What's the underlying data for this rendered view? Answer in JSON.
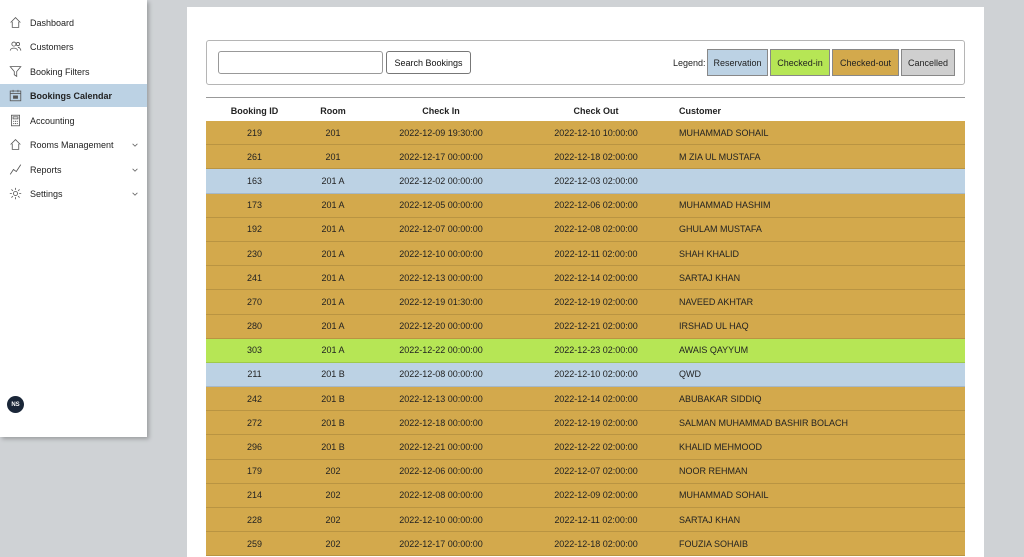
{
  "sidebar": {
    "items": [
      {
        "label": "Dashboard",
        "icon": "home-icon",
        "active": true,
        "chevron": false
      },
      {
        "label": "Customers",
        "icon": "users-icon",
        "active": false,
        "chevron": false
      },
      {
        "label": "Booking Filters",
        "icon": "filter-icon",
        "active": false,
        "chevron": false
      },
      {
        "label": "Bookings Calendar",
        "icon": "calendar-icon",
        "active": true,
        "chevron": false
      },
      {
        "label": "Accounting",
        "icon": "calculator-icon",
        "active": false,
        "chevron": false
      },
      {
        "label": "Rooms Management",
        "icon": "home-icon",
        "active": false,
        "chevron": true
      },
      {
        "label": "Reports",
        "icon": "chart-line-icon",
        "active": false,
        "chevron": true
      },
      {
        "label": "Settings",
        "icon": "gear-icon",
        "active": false,
        "chevron": true
      }
    ],
    "avatar": "NS"
  },
  "toolbar": {
    "search_placeholder": "",
    "search_value": "",
    "search_button": "Search Bookings",
    "legend_label": "Legend:",
    "legend": [
      {
        "label": "Reservation",
        "color": "#bcd2e4"
      },
      {
        "label": "Checked-in",
        "color": "#b6e655"
      },
      {
        "label": "Checked-out",
        "color": "#d3a94c"
      },
      {
        "label": "Cancelled",
        "color": "#cfcfcf"
      }
    ]
  },
  "table": {
    "headers": [
      "Booking ID",
      "Room",
      "Check In",
      "Check Out",
      "Customer"
    ],
    "rows": [
      {
        "id": "219",
        "room": "201",
        "check_in": "2022-12-09 19:30:00",
        "check_out": "2022-12-10 10:00:00",
        "customer": "MUHAMMAD SOHAIL",
        "status": "Checked-out"
      },
      {
        "id": "261",
        "room": "201",
        "check_in": "2022-12-17 00:00:00",
        "check_out": "2022-12-18 02:00:00",
        "customer": "M ZIA UL MUSTAFA",
        "status": "Checked-out"
      },
      {
        "id": "163",
        "room": "201 A",
        "check_in": "2022-12-02 00:00:00",
        "check_out": "2022-12-03 02:00:00",
        "customer": "",
        "status": "Reservation"
      },
      {
        "id": "173",
        "room": "201 A",
        "check_in": "2022-12-05 00:00:00",
        "check_out": "2022-12-06 02:00:00",
        "customer": "MUHAMMAD HASHIM",
        "status": "Checked-out"
      },
      {
        "id": "192",
        "room": "201 A",
        "check_in": "2022-12-07 00:00:00",
        "check_out": "2022-12-08 02:00:00",
        "customer": "GHULAM MUSTAFA",
        "status": "Checked-out"
      },
      {
        "id": "230",
        "room": "201 A",
        "check_in": "2022-12-10 00:00:00",
        "check_out": "2022-12-11 02:00:00",
        "customer": "SHAH KHALID",
        "status": "Checked-out"
      },
      {
        "id": "241",
        "room": "201 A",
        "check_in": "2022-12-13 00:00:00",
        "check_out": "2022-12-14 02:00:00",
        "customer": "SARTAJ KHAN",
        "status": "Checked-out"
      },
      {
        "id": "270",
        "room": "201 A",
        "check_in": "2022-12-19 01:30:00",
        "check_out": "2022-12-19 02:00:00",
        "customer": "NAVEED AKHTAR",
        "status": "Checked-out"
      },
      {
        "id": "280",
        "room": "201 A",
        "check_in": "2022-12-20 00:00:00",
        "check_out": "2022-12-21 02:00:00",
        "customer": "IRSHAD UL HAQ",
        "status": "Checked-out"
      },
      {
        "id": "303",
        "room": "201 A",
        "check_in": "2022-12-22 00:00:00",
        "check_out": "2022-12-23 02:00:00",
        "customer": "AWAIS QAYYUM",
        "status": "Checked-in"
      },
      {
        "id": "211",
        "room": "201 B",
        "check_in": "2022-12-08 00:00:00",
        "check_out": "2022-12-10 02:00:00",
        "customer": "QWD",
        "status": "Reservation"
      },
      {
        "id": "242",
        "room": "201 B",
        "check_in": "2022-12-13 00:00:00",
        "check_out": "2022-12-14 02:00:00",
        "customer": "ABUBAKAR SIDDIQ",
        "status": "Checked-out"
      },
      {
        "id": "272",
        "room": "201 B",
        "check_in": "2022-12-18 00:00:00",
        "check_out": "2022-12-19 02:00:00",
        "customer": "SALMAN MUHAMMAD BASHIR BOLACH",
        "status": "Checked-out"
      },
      {
        "id": "296",
        "room": "201 B",
        "check_in": "2022-12-21 00:00:00",
        "check_out": "2022-12-22 02:00:00",
        "customer": "KHALID MEHMOOD",
        "status": "Checked-out"
      },
      {
        "id": "179",
        "room": "202",
        "check_in": "2022-12-06 00:00:00",
        "check_out": "2022-12-07 02:00:00",
        "customer": "NOOR REHMAN",
        "status": "Checked-out"
      },
      {
        "id": "214",
        "room": "202",
        "check_in": "2022-12-08 00:00:00",
        "check_out": "2022-12-09 02:00:00",
        "customer": "MUHAMMAD SOHAIL",
        "status": "Checked-out"
      },
      {
        "id": "228",
        "room": "202",
        "check_in": "2022-12-10 00:00:00",
        "check_out": "2022-12-11 02:00:00",
        "customer": "SARTAJ KHAN",
        "status": "Checked-out"
      },
      {
        "id": "259",
        "room": "202",
        "check_in": "2022-12-17 00:00:00",
        "check_out": "2022-12-18 02:00:00",
        "customer": "FOUZIA SOHAIB",
        "status": "Checked-out"
      }
    ]
  }
}
